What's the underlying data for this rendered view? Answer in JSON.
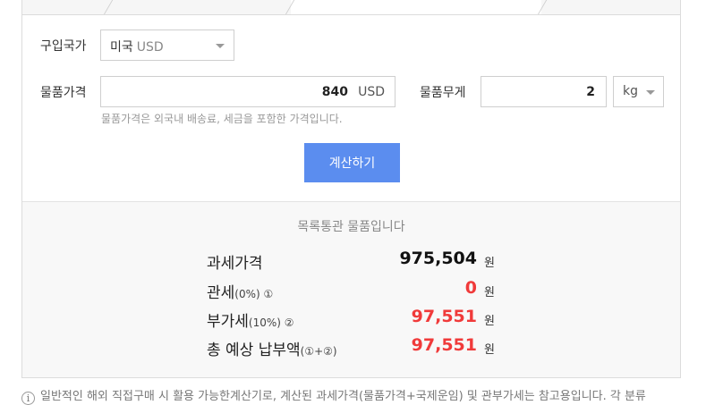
{
  "form": {
    "country_label": "구입국가",
    "country_value": "미국",
    "country_currency": "USD",
    "price_label": "물품가격",
    "price_value": "840",
    "price_unit": "USD",
    "weight_label": "물품무게",
    "weight_value": "2",
    "weight_unit": "kg",
    "help_text": "물품가격은 외국내 배송료, 세금을 포함한 가격입니다.",
    "calc_button": "계산하기"
  },
  "result": {
    "title": "목록통관 물품입니다",
    "rows": [
      {
        "label": "과세가격",
        "note": "",
        "value": "975,504",
        "unit": "원"
      },
      {
        "label": "관세",
        "note": "(0%) ①",
        "value": "0",
        "unit": "원"
      },
      {
        "label": "부가세",
        "note": "(10%) ②",
        "value": "97,551",
        "unit": "원"
      },
      {
        "label": "총 예상 납부액",
        "note": "(①+②)",
        "value": "97,551",
        "unit": "원"
      }
    ]
  },
  "footer": {
    "icon": "i",
    "note": "일반적인 해외 직접구매 시 활용 가능한계산기로, 계산된 과세가격(물품가격+국제운임) 및 관부가세는 참고용입니다. 각 분류"
  },
  "colors": {
    "accent": "#5b8def",
    "red": "#f03a3a"
  }
}
